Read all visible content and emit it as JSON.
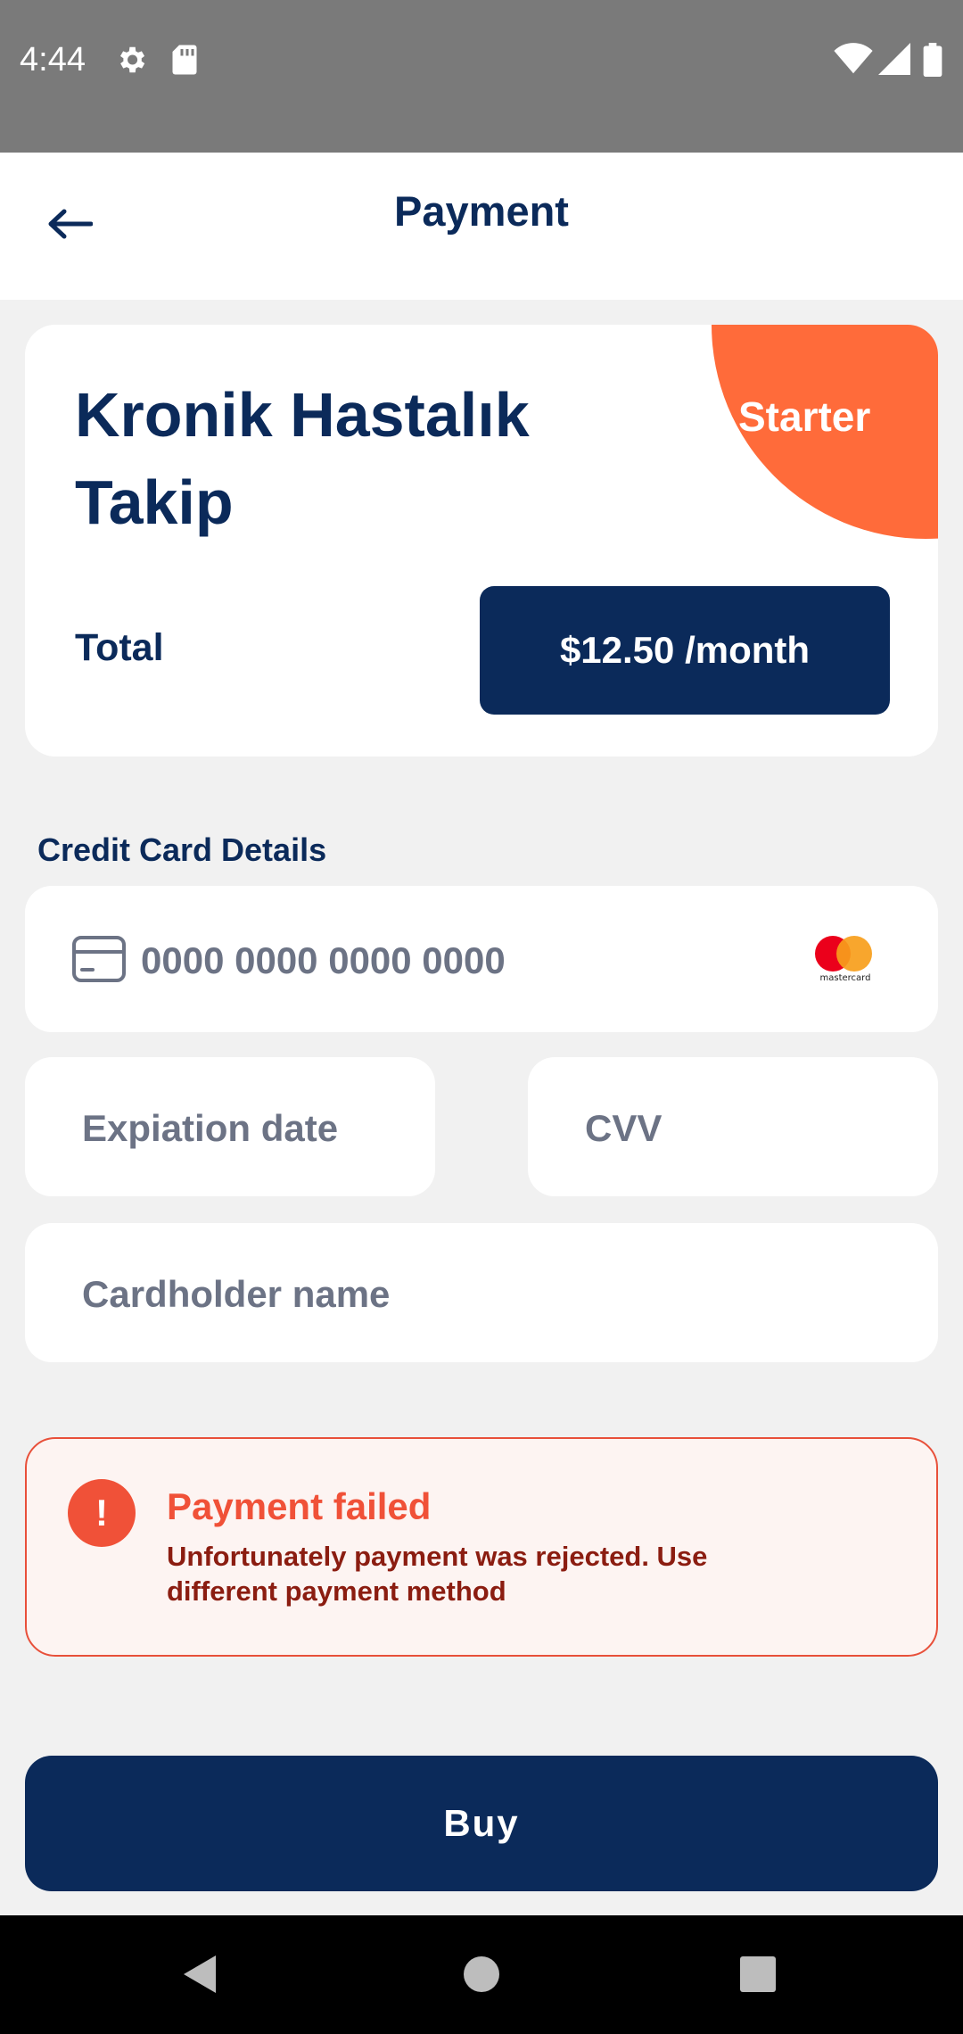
{
  "status_bar": {
    "time": "4:44",
    "icons": [
      "gear-icon",
      "sd-card-icon",
      "wifi-icon",
      "signal-icon",
      "battery-icon"
    ]
  },
  "app_bar": {
    "back_icon": "arrow-left-icon",
    "title": "Payment"
  },
  "plan": {
    "name": "Kronik Hastalık Takip",
    "badge": "Starter",
    "total_label": "Total",
    "price": "$12.50 /month"
  },
  "credit_card": {
    "section_label": "Credit Card Details",
    "card_number_placeholder": "0000 0000 0000 0000",
    "card_brand": "mastercard",
    "expiration_placeholder": "Expiation date",
    "cvv_placeholder": "CVV",
    "cardholder_placeholder": "Cardholder name"
  },
  "alert": {
    "icon": "!",
    "title": "Payment failed",
    "message": "Unfortunately payment was rejected. Use different payment method"
  },
  "buy_button": "Buy",
  "colors": {
    "primary": "#0b2a5a",
    "accent": "#ff6b3a",
    "error": "#f05138",
    "background": "#f1f1f1"
  },
  "nav_bar": {
    "icons": [
      "back-triangle-icon",
      "home-circle-icon",
      "recents-square-icon"
    ]
  }
}
